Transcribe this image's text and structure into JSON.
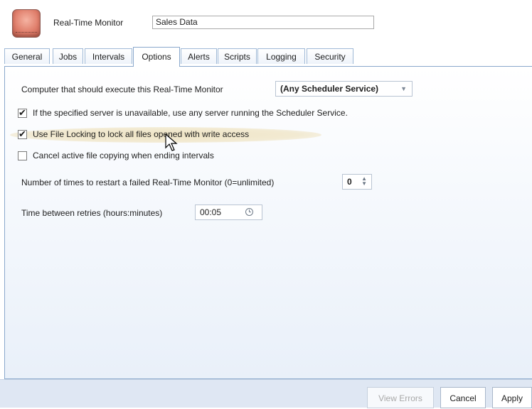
{
  "header": {
    "title_label": "Real-Time Monitor",
    "name_value": "Sales Data"
  },
  "tabs": [
    {
      "label": "General",
      "active": false
    },
    {
      "label": "Jobs",
      "active": false
    },
    {
      "label": "Intervals",
      "active": false
    },
    {
      "label": "Options",
      "active": true
    },
    {
      "label": "Alerts",
      "active": false
    },
    {
      "label": "Scripts",
      "active": false
    },
    {
      "label": "Logging",
      "active": false
    },
    {
      "label": "Security",
      "active": false
    }
  ],
  "options": {
    "computer_label": "Computer that should execute this Real-Time Monitor",
    "computer_value": "(Any Scheduler Service)",
    "checkbox_any_server": {
      "label": "If the specified server is unavailable, use any server running the Scheduler Service.",
      "checked": true
    },
    "checkbox_file_locking": {
      "label": "Use File Locking to lock all files opened with write access",
      "checked": true
    },
    "checkbox_cancel_copy": {
      "label": "Cancel active file copying when ending intervals",
      "checked": false
    },
    "restart_label": "Number of times to restart a failed Real-Time Monitor (0=unlimited)",
    "restart_value": "0",
    "retry_label": "Time between retries (hours:minutes)",
    "retry_value": "00:05"
  },
  "footer": {
    "view_errors_label": "View Errors",
    "cancel_label": "Cancel",
    "apply_label": "Apply"
  },
  "icons": {
    "check_glyph": "✔",
    "dropdown_glyph": "▼",
    "spin_glyph": "▲▼"
  }
}
